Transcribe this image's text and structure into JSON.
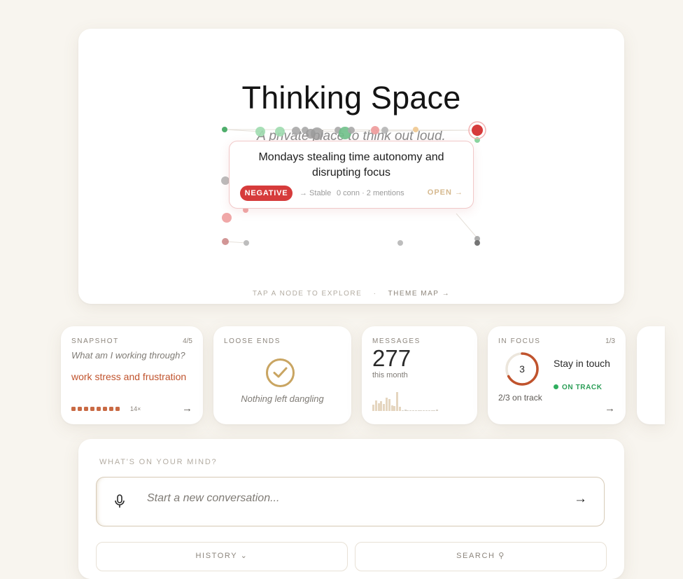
{
  "hero": {
    "title": "Thinking Space",
    "subtitle": "A private place to think out loud.",
    "hint": "TAP A NODE TO EXPLORE",
    "hint_separator": "·",
    "theme_map_label": "THEME MAP →"
  },
  "selected_theme": {
    "title": "Mondays stealing time autonomy and disrupting focus",
    "sentiment": "NEGATIVE",
    "trend": "→ Stable",
    "meta": "0 conn · 2 mentions",
    "open_label": "OPEN →"
  },
  "colors": {
    "negative": "#d63b3b",
    "positive": "#9fdcaf",
    "neutral": "#bdbdbd",
    "accent_gold": "#c9a562",
    "accent_orange": "#c0532d",
    "on_track_green": "#2fae5e"
  },
  "tiles": {
    "snapshot": {
      "label": "SNAPSHOT",
      "count": "4/5",
      "question": "What am I working through?",
      "topic": "work stress and frustration",
      "mentions": "14×",
      "mention_dots": 8,
      "arrow_icon": "arrow-right-icon"
    },
    "loose_ends": {
      "label": "LOOSE ENDS",
      "icon": "check-circle-icon",
      "text": "Nothing left dangling"
    },
    "messages": {
      "label": "MESSAGES",
      "count": "277",
      "sub": "this month",
      "daily_counts": [
        9,
        14,
        11,
        13,
        10,
        18,
        16,
        8,
        7,
        26,
        6,
        1,
        2,
        1,
        1,
        1,
        1,
        1,
        1,
        1,
        1,
        1,
        1,
        1,
        2
      ]
    },
    "focus": {
      "label": "IN FOCUS",
      "count": "1/3",
      "ring_number": "3",
      "ring_fraction": 0.67,
      "goal": "Stay in touch",
      "status": "ON TRACK",
      "progress": "2/3 on track",
      "arrow_icon": "arrow-right-icon"
    }
  },
  "composer": {
    "label": "WHAT'S ON YOUR MIND?",
    "placeholder": "Start a new conversation...",
    "mic_icon": "microphone-icon",
    "send_icon": "arrow-right-icon",
    "history_label": "HISTORY ⌄",
    "search_label": "SEARCH ⚲"
  }
}
